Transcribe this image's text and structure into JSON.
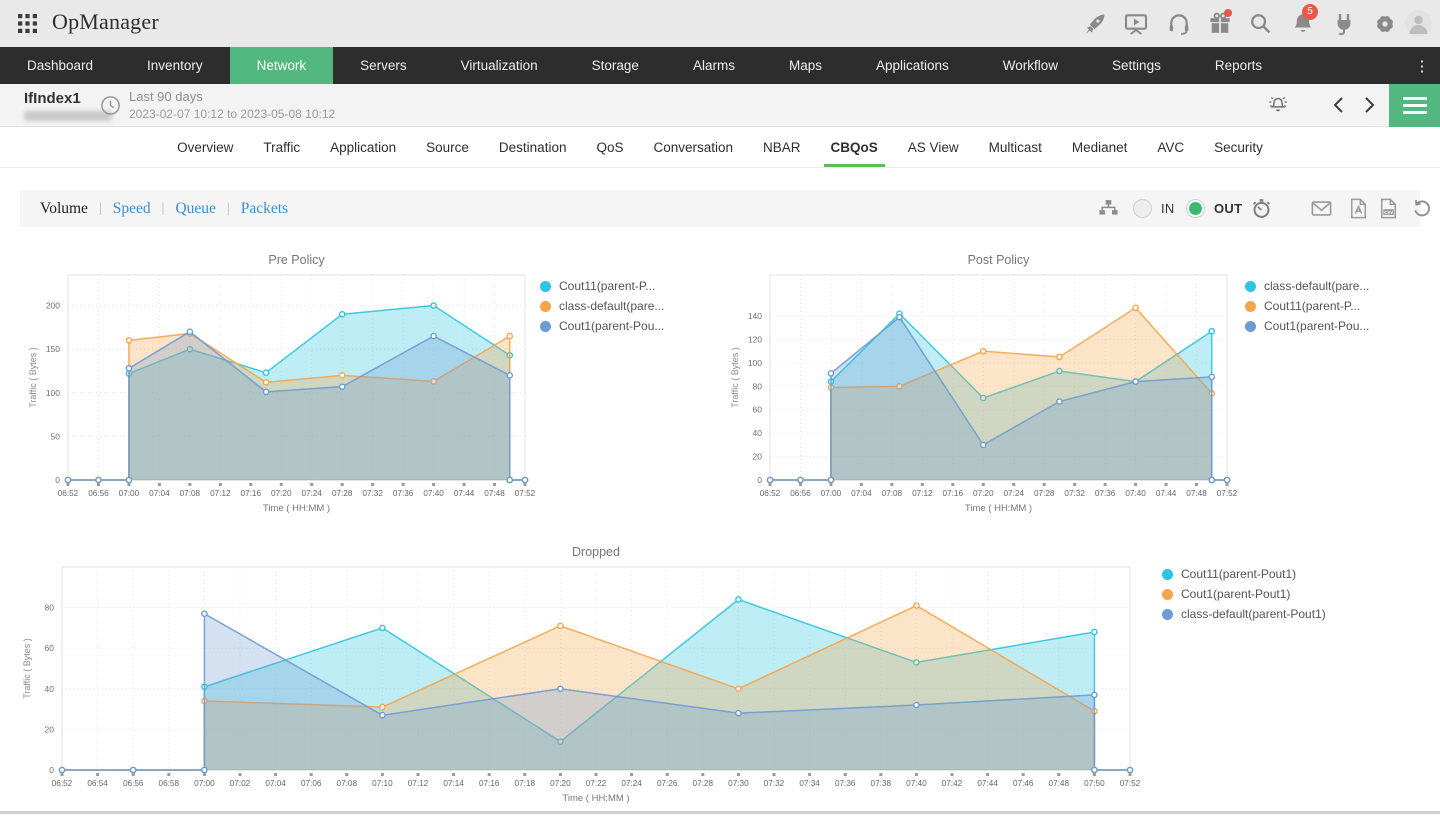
{
  "app": {
    "title": "OpManager"
  },
  "topbar": {
    "badge_count": "5",
    "icons": [
      "app-grid",
      "rocket",
      "presentation",
      "headset",
      "gift",
      "search",
      "bell",
      "plug",
      "gear",
      "avatar"
    ]
  },
  "nav": {
    "active": "Network",
    "items": [
      "Dashboard",
      "Inventory",
      "Network",
      "Servers",
      "Virtualization",
      "Storage",
      "Alarms",
      "Maps",
      "Applications",
      "Workflow",
      "Settings",
      "Reports"
    ]
  },
  "page_header": {
    "title": "IfIndex1",
    "period": "Last 90 days",
    "range": "2023-02-07 10:12 to 2023-05-08 10:12"
  },
  "tabs": {
    "active": "CBQoS",
    "items": [
      "Overview",
      "Traffic",
      "Application",
      "Source",
      "Destination",
      "QoS",
      "Conversation",
      "NBAR",
      "CBQoS",
      "AS View",
      "Multicast",
      "Medianet",
      "AVC",
      "Security"
    ]
  },
  "toolbar": {
    "active_view": "Volume",
    "views": [
      "Volume",
      "Speed",
      "Queue",
      "Packets"
    ],
    "in_label": "IN",
    "out_label": "OUT",
    "selected_direction": "OUT",
    "icons": [
      "hierarchy",
      "timer",
      "mail",
      "pdf",
      "csv",
      "reset"
    ]
  },
  "colors": {
    "accent_green": "#53b87f",
    "tab_underline_green": "#5bbf57",
    "link_blue": "#3a8ed0",
    "badge_red": "#e8584b"
  },
  "chart_data": [
    {
      "type": "area",
      "title": "Pre Policy",
      "xlabel": "Time ( HH:MM )",
      "ylabel": "Traffic ( Bytes )",
      "x_start": "06:52",
      "x_end": "07:52",
      "xtick_interval_min": 4,
      "ylim": [
        0,
        235
      ],
      "yticks": [
        0,
        50,
        100,
        150,
        200
      ],
      "grid": true,
      "legend_position": "right",
      "series": [
        {
          "name": "Cout11(parent-P...",
          "color": "#2bc4e2",
          "points": [
            [
              "06:52",
              0
            ],
            [
              "06:56",
              0
            ],
            [
              "07:00",
              0
            ],
            [
              "07:00",
              122
            ],
            [
              "07:08",
              150
            ],
            [
              "07:18",
              123
            ],
            [
              "07:28",
              190
            ],
            [
              "07:40",
              200
            ],
            [
              "07:50",
              143
            ],
            [
              "07:50",
              0
            ],
            [
              "07:52",
              0
            ]
          ]
        },
        {
          "name": "class-default(pare...",
          "color": "#f6a44b",
          "points": [
            [
              "06:52",
              0
            ],
            [
              "06:56",
              0
            ],
            [
              "07:00",
              0
            ],
            [
              "07:00",
              160
            ],
            [
              "07:08",
              168
            ],
            [
              "07:18",
              112
            ],
            [
              "07:28",
              120
            ],
            [
              "07:40",
              113
            ],
            [
              "07:50",
              165
            ],
            [
              "07:50",
              0
            ],
            [
              "07:52",
              0
            ]
          ]
        },
        {
          "name": "Cout1(parent-Pou...",
          "color": "#6e9bd1",
          "points": [
            [
              "06:52",
              0
            ],
            [
              "06:56",
              0
            ],
            [
              "07:00",
              0
            ],
            [
              "07:00",
              128
            ],
            [
              "07:08",
              170
            ],
            [
              "07:18",
              101
            ],
            [
              "07:28",
              107
            ],
            [
              "07:40",
              165
            ],
            [
              "07:50",
              120
            ],
            [
              "07:50",
              0
            ],
            [
              "07:52",
              0
            ]
          ]
        }
      ]
    },
    {
      "type": "area",
      "title": "Post Policy",
      "xlabel": "Time ( HH:MM )",
      "ylabel": "Traffic ( Bytes )",
      "x_start": "06:52",
      "x_end": "07:52",
      "xtick_interval_min": 4,
      "ylim": [
        0,
        175
      ],
      "yticks": [
        0,
        20,
        40,
        60,
        80,
        100,
        120,
        140
      ],
      "grid": true,
      "legend_position": "right",
      "series": [
        {
          "name": "class-default(pare...",
          "color": "#2bc4e2",
          "points": [
            [
              "06:52",
              0
            ],
            [
              "06:56",
              0
            ],
            [
              "07:00",
              0
            ],
            [
              "07:00",
              84
            ],
            [
              "07:09",
              142
            ],
            [
              "07:20",
              70
            ],
            [
              "07:30",
              93
            ],
            [
              "07:40",
              84
            ],
            [
              "07:50",
              127
            ],
            [
              "07:50",
              0
            ],
            [
              "07:52",
              0
            ]
          ]
        },
        {
          "name": "Cout11(parent-P...",
          "color": "#f6a44b",
          "points": [
            [
              "06:52",
              0
            ],
            [
              "06:56",
              0
            ],
            [
              "07:00",
              0
            ],
            [
              "07:00",
              79
            ],
            [
              "07:09",
              80
            ],
            [
              "07:20",
              110
            ],
            [
              "07:30",
              105
            ],
            [
              "07:40",
              147
            ],
            [
              "07:50",
              74
            ],
            [
              "07:50",
              0
            ],
            [
              "07:52",
              0
            ]
          ]
        },
        {
          "name": "Cout1(parent-Pou...",
          "color": "#6e9bd1",
          "points": [
            [
              "06:52",
              0
            ],
            [
              "06:56",
              0
            ],
            [
              "07:00",
              0
            ],
            [
              "07:00",
              91
            ],
            [
              "07:09",
              139
            ],
            [
              "07:20",
              30
            ],
            [
              "07:30",
              67
            ],
            [
              "07:40",
              84
            ],
            [
              "07:50",
              88
            ],
            [
              "07:50",
              0
            ],
            [
              "07:52",
              0
            ]
          ]
        }
      ]
    },
    {
      "type": "area",
      "title": "Dropped",
      "xlabel": "Time ( HH:MM )",
      "ylabel": "Traffic ( Bytes )",
      "x_start": "06:52",
      "x_end": "07:52",
      "xtick_interval_min": 2,
      "ylim": [
        0,
        100
      ],
      "yticks": [
        0,
        20,
        40,
        60,
        80
      ],
      "grid": true,
      "legend_position": "right",
      "series": [
        {
          "name": "Cout11(parent-Pout1)",
          "color": "#2bc4e2",
          "points": [
            [
              "06:52",
              0
            ],
            [
              "06:56",
              0
            ],
            [
              "07:00",
              0
            ],
            [
              "07:00",
              41
            ],
            [
              "07:10",
              70
            ],
            [
              "07:20",
              14
            ],
            [
              "07:30",
              84
            ],
            [
              "07:40",
              53
            ],
            [
              "07:50",
              68
            ],
            [
              "07:50",
              0
            ],
            [
              "07:52",
              0
            ]
          ]
        },
        {
          "name": "Cout1(parent-Pout1)",
          "color": "#f6a44b",
          "points": [
            [
              "06:52",
              0
            ],
            [
              "06:56",
              0
            ],
            [
              "07:00",
              0
            ],
            [
              "07:00",
              34
            ],
            [
              "07:10",
              31
            ],
            [
              "07:20",
              71
            ],
            [
              "07:30",
              40
            ],
            [
              "07:40",
              81
            ],
            [
              "07:50",
              29
            ],
            [
              "07:50",
              0
            ],
            [
              "07:52",
              0
            ]
          ]
        },
        {
          "name": "class-default(parent-Pout1)",
          "color": "#6e9bd1",
          "points": [
            [
              "06:52",
              0
            ],
            [
              "06:56",
              0
            ],
            [
              "07:00",
              0
            ],
            [
              "07:00",
              77
            ],
            [
              "07:10",
              27
            ],
            [
              "07:20",
              40
            ],
            [
              "07:30",
              28
            ],
            [
              "07:40",
              32
            ],
            [
              "07:50",
              37
            ],
            [
              "07:50",
              0
            ],
            [
              "07:52",
              0
            ]
          ]
        }
      ]
    }
  ]
}
